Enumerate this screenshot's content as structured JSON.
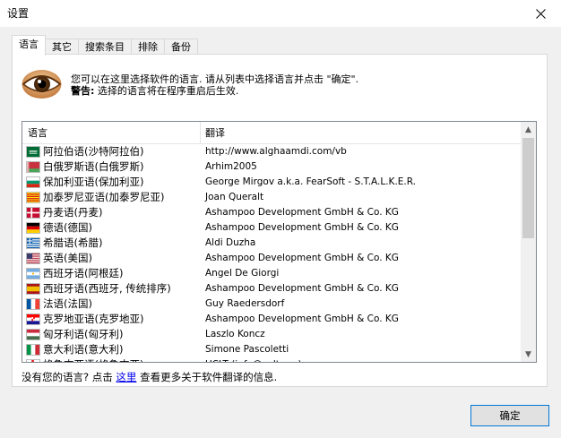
{
  "window": {
    "title": "设置"
  },
  "tabs": [
    {
      "label": "语言"
    },
    {
      "label": "其它"
    },
    {
      "label": "搜索条目"
    },
    {
      "label": "排除"
    },
    {
      "label": "备份"
    }
  ],
  "intro": {
    "line1": "您可以在这里选择软件的语言. 请从列表中选择语言并点击 \"确定\".",
    "warning_label": "警告:",
    "warning_text": " 选择的语言将在程序重启后生效."
  },
  "list": {
    "columns": {
      "language": "语言",
      "translation": "翻译"
    },
    "rows": [
      {
        "flag": "sa",
        "language": "阿拉伯语(沙特阿拉伯)",
        "translator": "http://www.alghaamdi.com/vb"
      },
      {
        "flag": "by",
        "language": "白俄罗斯语(白俄罗斯)",
        "translator": "Arhim2005"
      },
      {
        "flag": "bg",
        "language": "保加利亚语(保加利亚)",
        "translator": "George Mirgov a.k.a. FearSoft - S.T.A.L.K.E.R."
      },
      {
        "flag": "ct",
        "language": "加泰罗尼亚语(加泰罗尼亚)",
        "translator": "Joan Queralt"
      },
      {
        "flag": "dk",
        "language": "丹麦语(丹麦)",
        "translator": "Ashampoo Development GmbH & Co. KG"
      },
      {
        "flag": "de",
        "language": "德语(德国)",
        "translator": "Ashampoo Development GmbH & Co. KG"
      },
      {
        "flag": "gr",
        "language": "希腊语(希腊)",
        "translator": "Aldi Duzha"
      },
      {
        "flag": "us",
        "language": "英语(美国)",
        "translator": "Ashampoo Development GmbH & Co. KG"
      },
      {
        "flag": "ar",
        "language": "西班牙语(阿根廷)",
        "translator": "Angel De Giorgi"
      },
      {
        "flag": "es",
        "language": "西班牙语(西班牙, 传统排序)",
        "translator": "Ashampoo Development GmbH & Co. KG"
      },
      {
        "flag": "fr",
        "language": "法语(法国)",
        "translator": "Guy Raedersdorf"
      },
      {
        "flag": "hr",
        "language": "克罗地亚语(克罗地亚)",
        "translator": "Ashampoo Development GmbH & Co. KG"
      },
      {
        "flag": "hu",
        "language": "匈牙利语(匈牙利)",
        "translator": "Laszlo Koncz"
      },
      {
        "flag": "it",
        "language": "意大利语(意大利)",
        "translator": "Simone Pascoletti"
      },
      {
        "flag": "is",
        "language": "格鲁吉亚语(格鲁吉亚)",
        "translator": "UCLT (info@uclt.org)"
      }
    ]
  },
  "footer": {
    "prefix": "没有您的语言? 点击 ",
    "link": "这里",
    "suffix": " 查看更多关于软件翻译的信息."
  },
  "buttons": {
    "ok": "确定"
  }
}
